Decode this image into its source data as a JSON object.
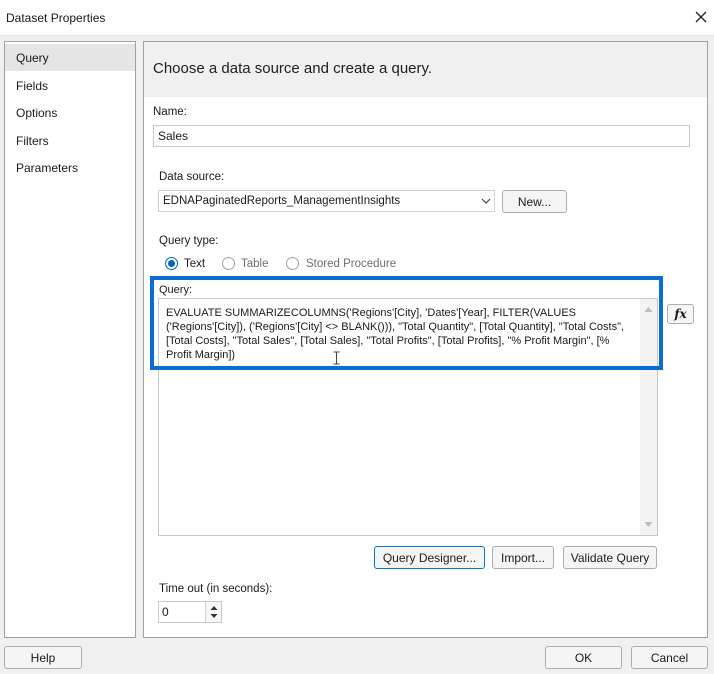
{
  "window": {
    "title": "Dataset Properties"
  },
  "nav": {
    "items": [
      {
        "label": "Query",
        "selected": true
      },
      {
        "label": "Fields",
        "selected": false
      },
      {
        "label": "Options",
        "selected": false
      },
      {
        "label": "Filters",
        "selected": false
      },
      {
        "label": "Parameters",
        "selected": false
      }
    ]
  },
  "main": {
    "header": "Choose a data source and create a query.",
    "name": {
      "label": "Name:",
      "value": "Sales"
    },
    "datasource": {
      "label": "Data source:",
      "value": "EDNAPaginatedReports_ManagementInsights",
      "new_button": "New..."
    },
    "query_type": {
      "label": "Query type:",
      "options": [
        {
          "label": "Text",
          "selected": true
        },
        {
          "label": "Table",
          "selected": false
        },
        {
          "label": "Stored Procedure",
          "selected": false
        }
      ]
    },
    "query": {
      "label": "Query:",
      "text": "EVALUATE SUMMARIZECOLUMNS('Regions'[City], 'Dates'[Year], FILTER(VALUES ('Regions'[City]), ('Regions'[City] <> BLANK())), \"Total Quantity\", [Total Quantity], \"Total Costs\", [Total Costs], \"Total Sales\", [Total Sales], \"Total Profits\", [Total Profits], \"% Profit Margin\", [% Profit Margin])",
      "fx_label": "fx"
    },
    "buttons": {
      "query_designer": "Query Designer...",
      "import": "Import...",
      "validate": "Validate Query"
    },
    "timeout": {
      "label": "Time out (in seconds):",
      "value": "0"
    }
  },
  "footer": {
    "help": "Help",
    "ok": "OK",
    "cancel": "Cancel"
  },
  "colors": {
    "highlight": "#0a6dcf",
    "accent": "#0067c0"
  }
}
